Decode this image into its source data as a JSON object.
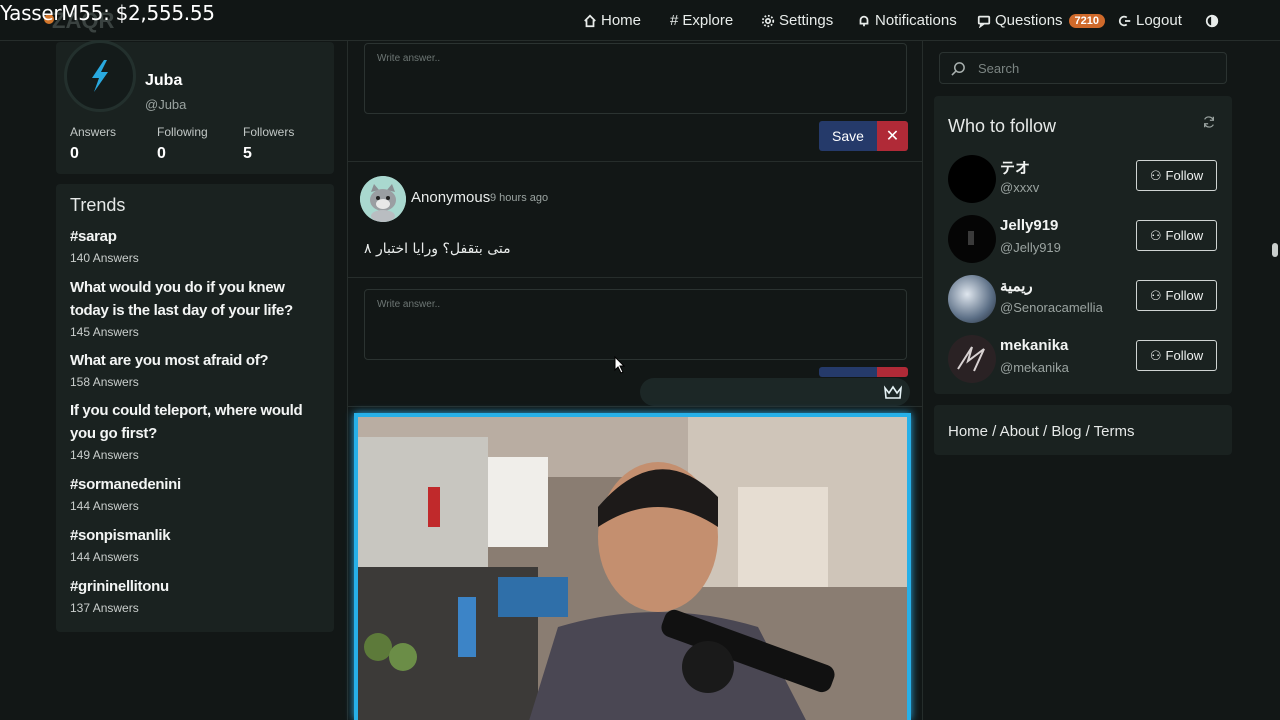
{
  "overlay": {
    "title": "YasserM55: $2,555.55"
  },
  "nav": {
    "home": "Home",
    "explore": "Explore",
    "settings": "Settings",
    "notifications": "Notifications",
    "questions": "Questions",
    "questions_badge": "7210",
    "logout": "Logout"
  },
  "profile": {
    "name": "Juba",
    "handle": "@Juba",
    "stats": [
      {
        "label": "Answers",
        "value": "0"
      },
      {
        "label": "Following",
        "value": "0"
      },
      {
        "label": "Followers",
        "value": "5"
      }
    ]
  },
  "trends": {
    "title": "Trends",
    "items": [
      {
        "question": "#sarap",
        "count": "140 Answers"
      },
      {
        "question": "What would you do if you knew today is the last day of your life?",
        "count": "145 Answers"
      },
      {
        "question": "What are you most afraid of?",
        "count": "158 Answers"
      },
      {
        "question": "If you could teleport, where would you go first?",
        "count": "149 Answers"
      },
      {
        "question": "#sormanedenini",
        "count": "144 Answers"
      },
      {
        "question": "#sonpismanlik",
        "count": "144 Answers"
      },
      {
        "question": "#grininellitonu",
        "count": "137 Answers"
      }
    ]
  },
  "feed": {
    "answer_placeholder": "Write answer..",
    "save_label": "Save",
    "close_glyph": "✕",
    "post": {
      "author": "Anonymous",
      "time": "9 hours ago",
      "text": "متى بتقفل؟ ورايا اختبار ٨"
    }
  },
  "sidebar": {
    "search_placeholder": "Search",
    "who_to_follow": "Who to follow",
    "follow_label": "Follow",
    "users": [
      {
        "name": "テオ",
        "handle": "@xxxv"
      },
      {
        "name": "Jelly919",
        "handle": "@Jelly919"
      },
      {
        "name": "ريمية",
        "handle": "@Senoracamellia"
      },
      {
        "name": "mekanika",
        "handle": "@mekanika"
      }
    ],
    "footer_links": "Home / About / Blog / Terms"
  },
  "colors": {
    "accent_blue": "#253a6a",
    "danger_red": "#b02a37",
    "badge_orange": "#d06a2b",
    "cam_border": "#27b0e8"
  }
}
